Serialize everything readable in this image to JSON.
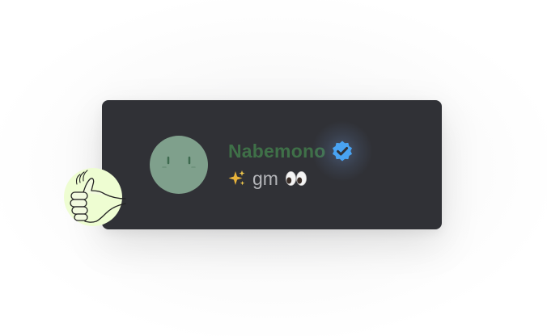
{
  "profile": {
    "display_name": "Nabemono",
    "status_text": "gm",
    "verified": true
  },
  "icons": {
    "avatar": "sleepy-face-avatar",
    "verified": "verified-badge-icon",
    "status_prefix": "sparkles-icon",
    "status_suffix": "eyes-icon",
    "reaction": "thumbs-up-icon"
  },
  "colors": {
    "card_background": "#303136",
    "name_color": "#3f7048",
    "status_color": "#b4b5b9",
    "avatar_background": "#7fa08c",
    "verified_badge": "#49a3f2",
    "thumb_background": "#eefdd2"
  }
}
